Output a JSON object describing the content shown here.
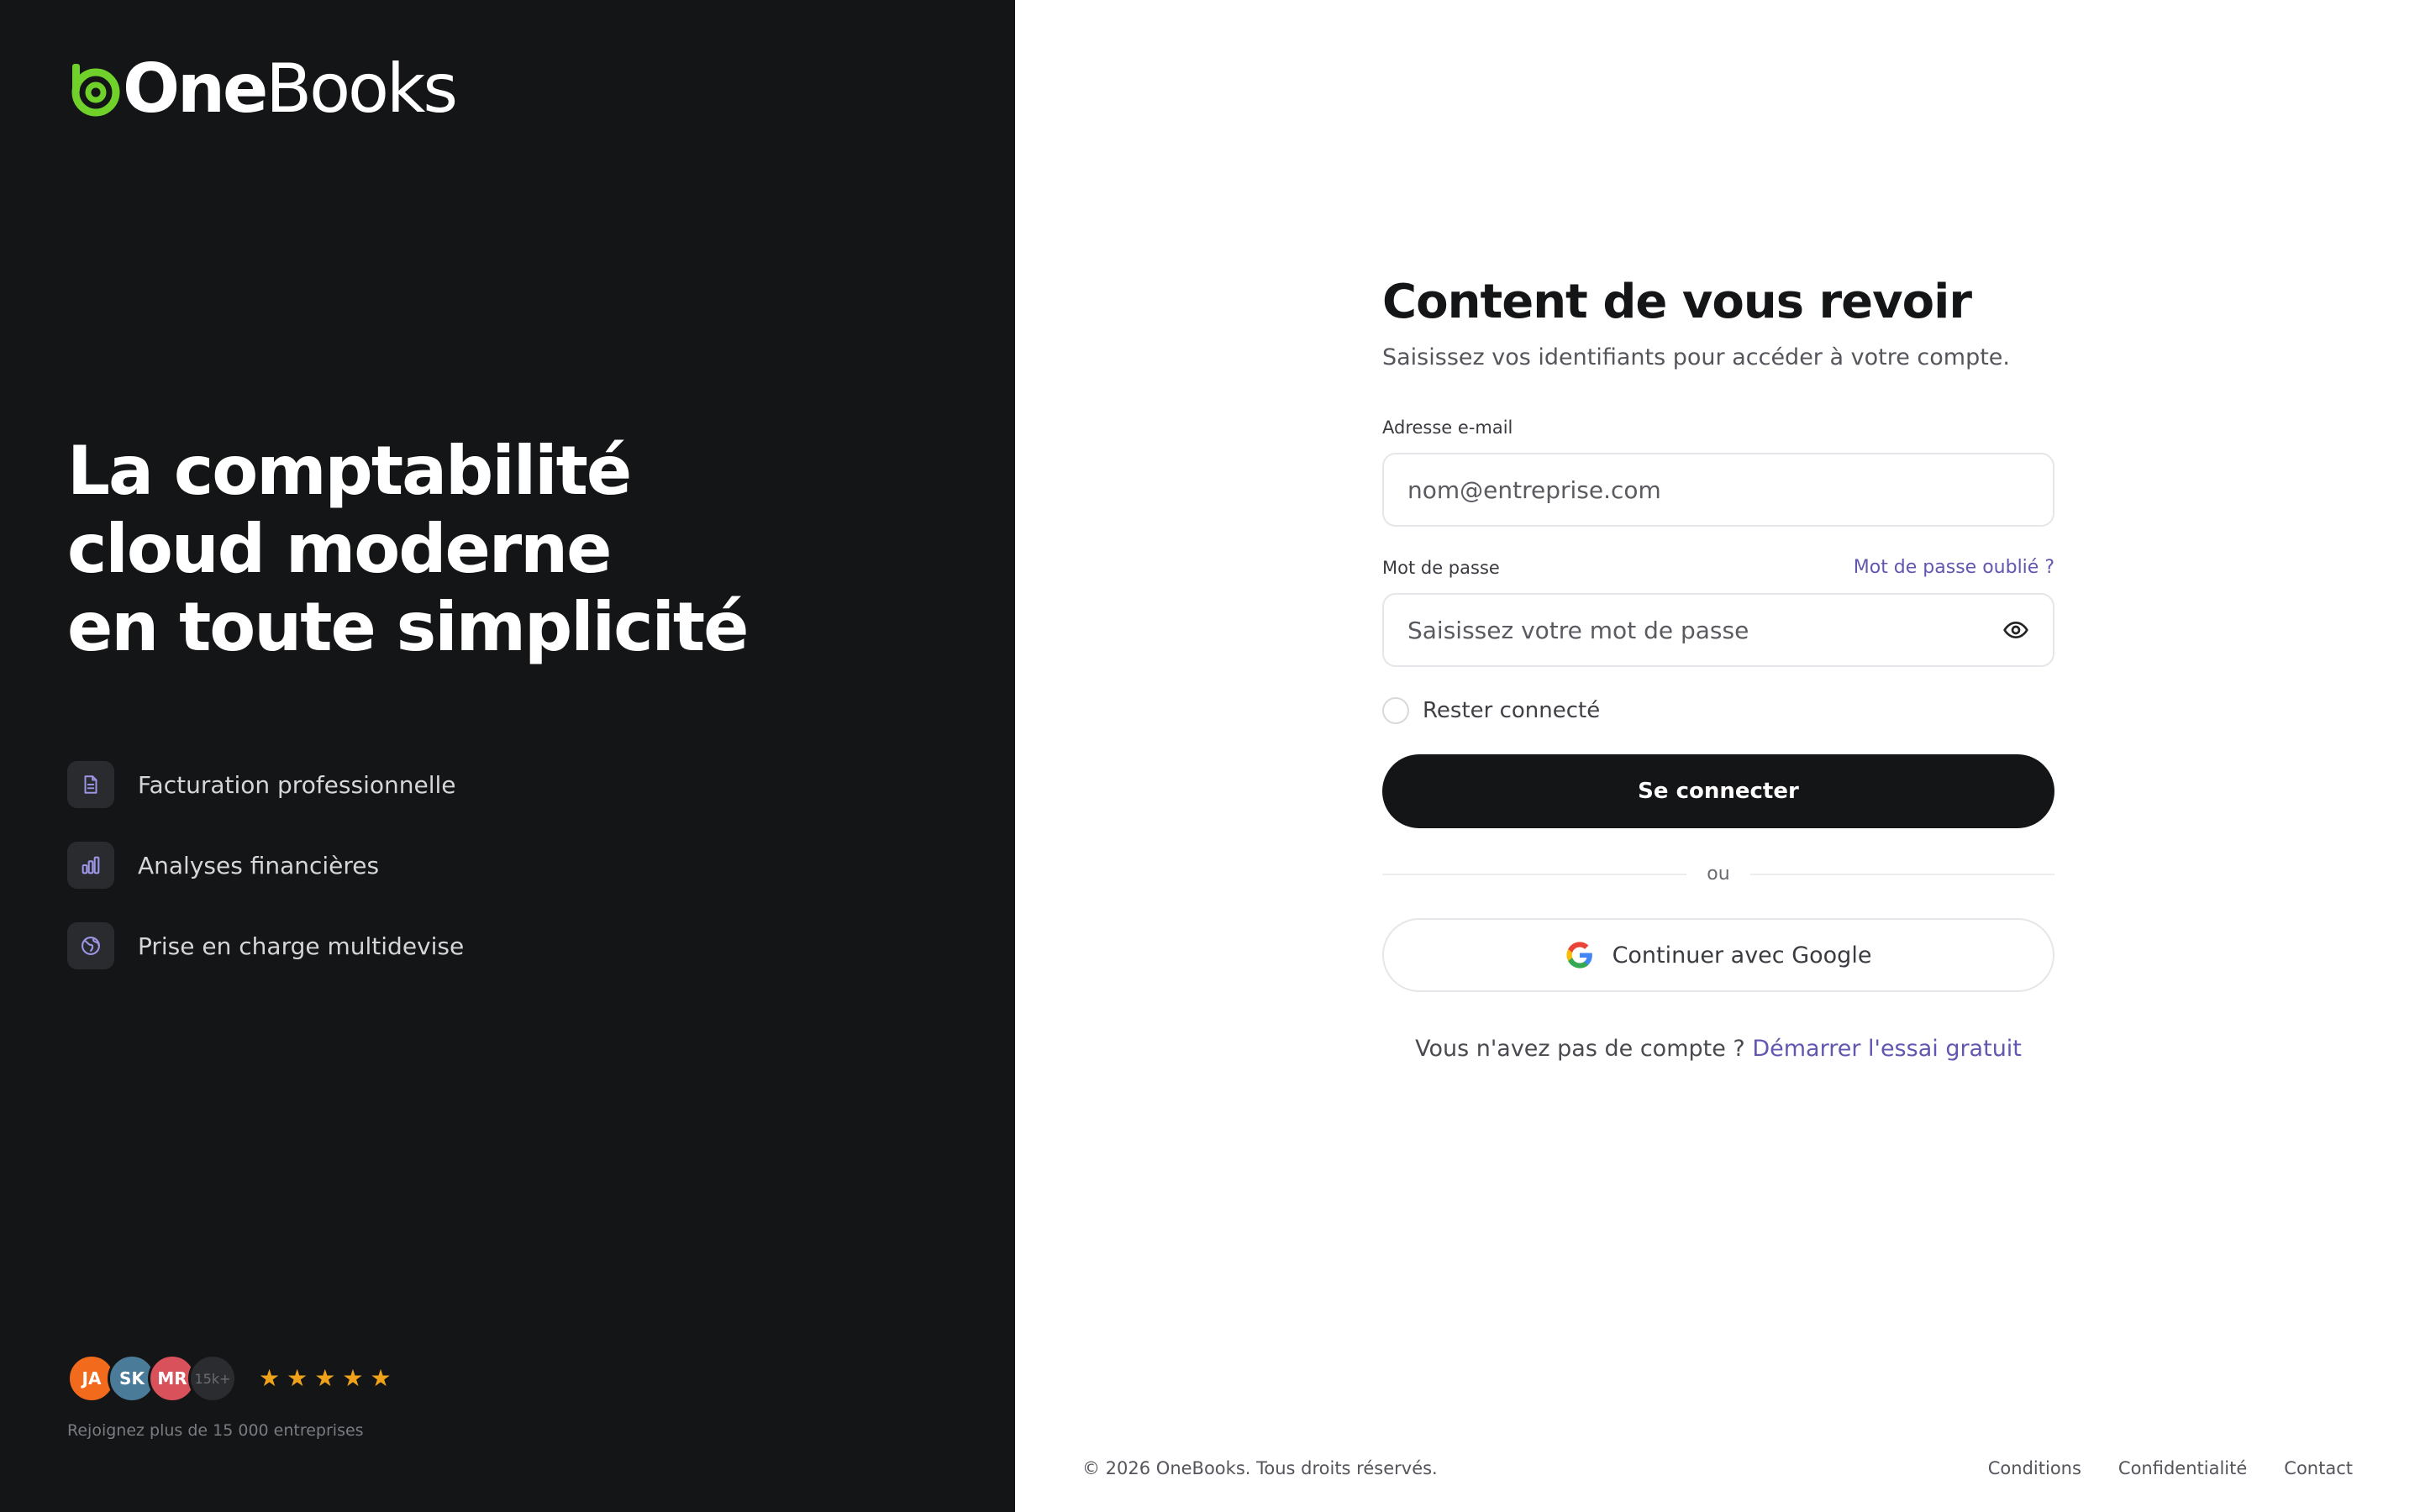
{
  "brand": {
    "name_part1": "One",
    "name_part2": "Books",
    "accent_color": "#6fd12a"
  },
  "hero": {
    "headline_lines": [
      "La comptabilité",
      "cloud moderne",
      "en toute simplicité"
    ]
  },
  "features": [
    {
      "icon": "document-icon",
      "label": "Facturation professionnelle"
    },
    {
      "icon": "bar-chart-icon",
      "label": "Analyses financières"
    },
    {
      "icon": "globe-icon",
      "label": "Prise en charge multidevise"
    }
  ],
  "social_proof": {
    "avatars": [
      {
        "initials": "JA",
        "color": "#f26a1b"
      },
      {
        "initials": "SK",
        "color": "#4a7c99"
      },
      {
        "initials": "MR",
        "color": "#d9515a"
      },
      {
        "initials": "15k+",
        "color": "#2b2c30"
      }
    ],
    "rating": 5,
    "star_color": "#f0a21a",
    "caption": "Rejoignez plus de 15 000 entreprises"
  },
  "login": {
    "title": "Content de vous revoir",
    "subtitle": "Saisissez vos identifiants pour accéder à votre compte.",
    "email_label": "Adresse e-mail",
    "email_placeholder": "nom@entreprise.com",
    "password_label": "Mot de passe",
    "forgot_password": "Mot de passe oublié ?",
    "password_placeholder": "Saisissez votre mot de passe",
    "remember_label": "Rester connecté",
    "submit_label": "Se connecter",
    "divider_text": "ou",
    "google_label": "Continuer avec Google",
    "signup_prompt": "Vous n'avez pas de compte ? ",
    "signup_link": "Démarrer l'essai gratuit",
    "link_color": "#6157b0"
  },
  "footer": {
    "copyright": "© 2026 OneBooks. Tous droits réservés.",
    "links": [
      "Conditions",
      "Confidentialité",
      "Contact"
    ]
  }
}
